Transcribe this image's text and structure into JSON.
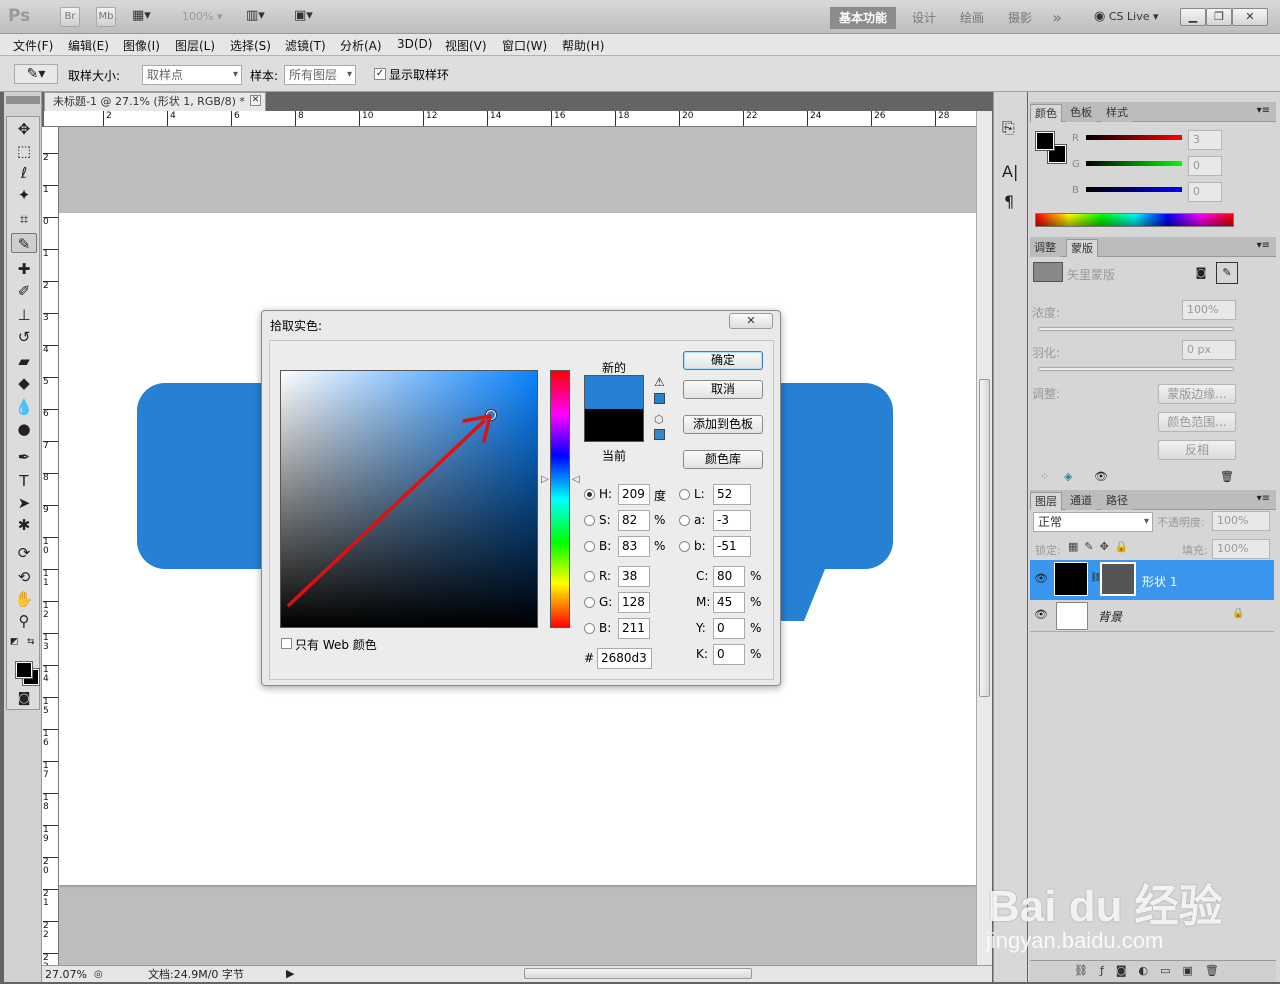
{
  "app": {
    "logo": "Ps",
    "bridge": "Br",
    "mini_bridge": "Mb",
    "zoom_display": "100%"
  },
  "workspaces": [
    "基本功能",
    "设计",
    "绘画",
    "摄影",
    "»"
  ],
  "cslive": "CS Live",
  "menu": [
    "文件(F)",
    "编辑(E)",
    "图像(I)",
    "图层(L)",
    "选择(S)",
    "滤镜(T)",
    "分析(A)",
    "3D(D)",
    "视图(V)",
    "窗口(W)",
    "帮助(H)"
  ],
  "options": {
    "sample_size_label": "取样大小:",
    "sample_size_value": "取样点",
    "sample_label": "样本:",
    "sample_value": "所有图层",
    "show_ring_label": "显示取样环"
  },
  "document": {
    "tab_title": "未标题-1 @ 27.1% (形状 1, RGB/8) *",
    "zoom": "27.07%",
    "doc_info": "文档:24.9M/0 字节"
  },
  "rulers": {
    "h": [
      "2",
      "4",
      "6",
      "8",
      "10",
      "12",
      "14",
      "16",
      "18",
      "20",
      "22",
      "24",
      "26",
      "28"
    ],
    "v": [
      "2",
      "1",
      "0",
      "1",
      "2",
      "3",
      "4",
      "5",
      "6",
      "7",
      "8",
      "9",
      "1\n0",
      "1\n1",
      "1\n2",
      "1\n3",
      "1\n4",
      "1\n5",
      "1\n6",
      "1\n7",
      "1\n8",
      "1\n9",
      "2\n0",
      "2\n1",
      "2\n2",
      "2\n3"
    ]
  },
  "color_panel": {
    "tabs": [
      "颜色",
      "色板",
      "样式"
    ],
    "r_label": "R",
    "g_label": "G",
    "b_label": "B",
    "r": "3",
    "g": "0",
    "b": "0"
  },
  "mask_panel": {
    "tabs": [
      "调整",
      "蒙版"
    ],
    "mask_type": "矢里蒙版",
    "density_label": "浓度:",
    "density": "100%",
    "feather_label": "羽化:",
    "feather": "0 px",
    "adjust_label": "调整:",
    "edge_btn": "蒙版边缘...",
    "range_btn": "颜色范围...",
    "invert_btn": "反相"
  },
  "layers_panel": {
    "tabs": [
      "图层",
      "通道",
      "路径"
    ],
    "blend_mode": "正常",
    "opacity_label": "不透明度:",
    "opacity": "100%",
    "lock_label": "锁定:",
    "fill_label": "填充:",
    "fill": "100%",
    "layers": [
      {
        "name": "形状 1",
        "selected": true
      },
      {
        "name": "背景",
        "selected": false
      }
    ]
  },
  "dialog": {
    "title": "拾取实色:",
    "new_label": "新的",
    "current_label": "当前",
    "ok": "确定",
    "cancel": "取消",
    "add_swatch": "添加到色板",
    "color_libs": "颜色库",
    "h_label": "H:",
    "h": "209",
    "h_unit": "度",
    "s_label": "S:",
    "s": "82",
    "s_unit": "%",
    "br_label": "B:",
    "br": "83",
    "br_unit": "%",
    "r_label": "R:",
    "r": "38",
    "g_label": "G:",
    "g": "128",
    "b_label": "B:",
    "b": "211",
    "l_label": "L:",
    "l": "52",
    "a_label": "a:",
    "a": "-3",
    "lb_label": "b:",
    "lb": "-51",
    "c_label": "C:",
    "c": "80",
    "m_label": "M:",
    "m": "45",
    "y_label": "Y:",
    "y": "0",
    "k_label": "K:",
    "k": "0",
    "cmyk_unit": "%",
    "hex_label": "#",
    "hex": "2680d3",
    "web_only": "只有 Web 颜色",
    "new_color": "#2680d3",
    "current_color": "#000000"
  },
  "watermark": {
    "brand": "Bai du 经验",
    "url": "jingyan.baidu.com"
  }
}
